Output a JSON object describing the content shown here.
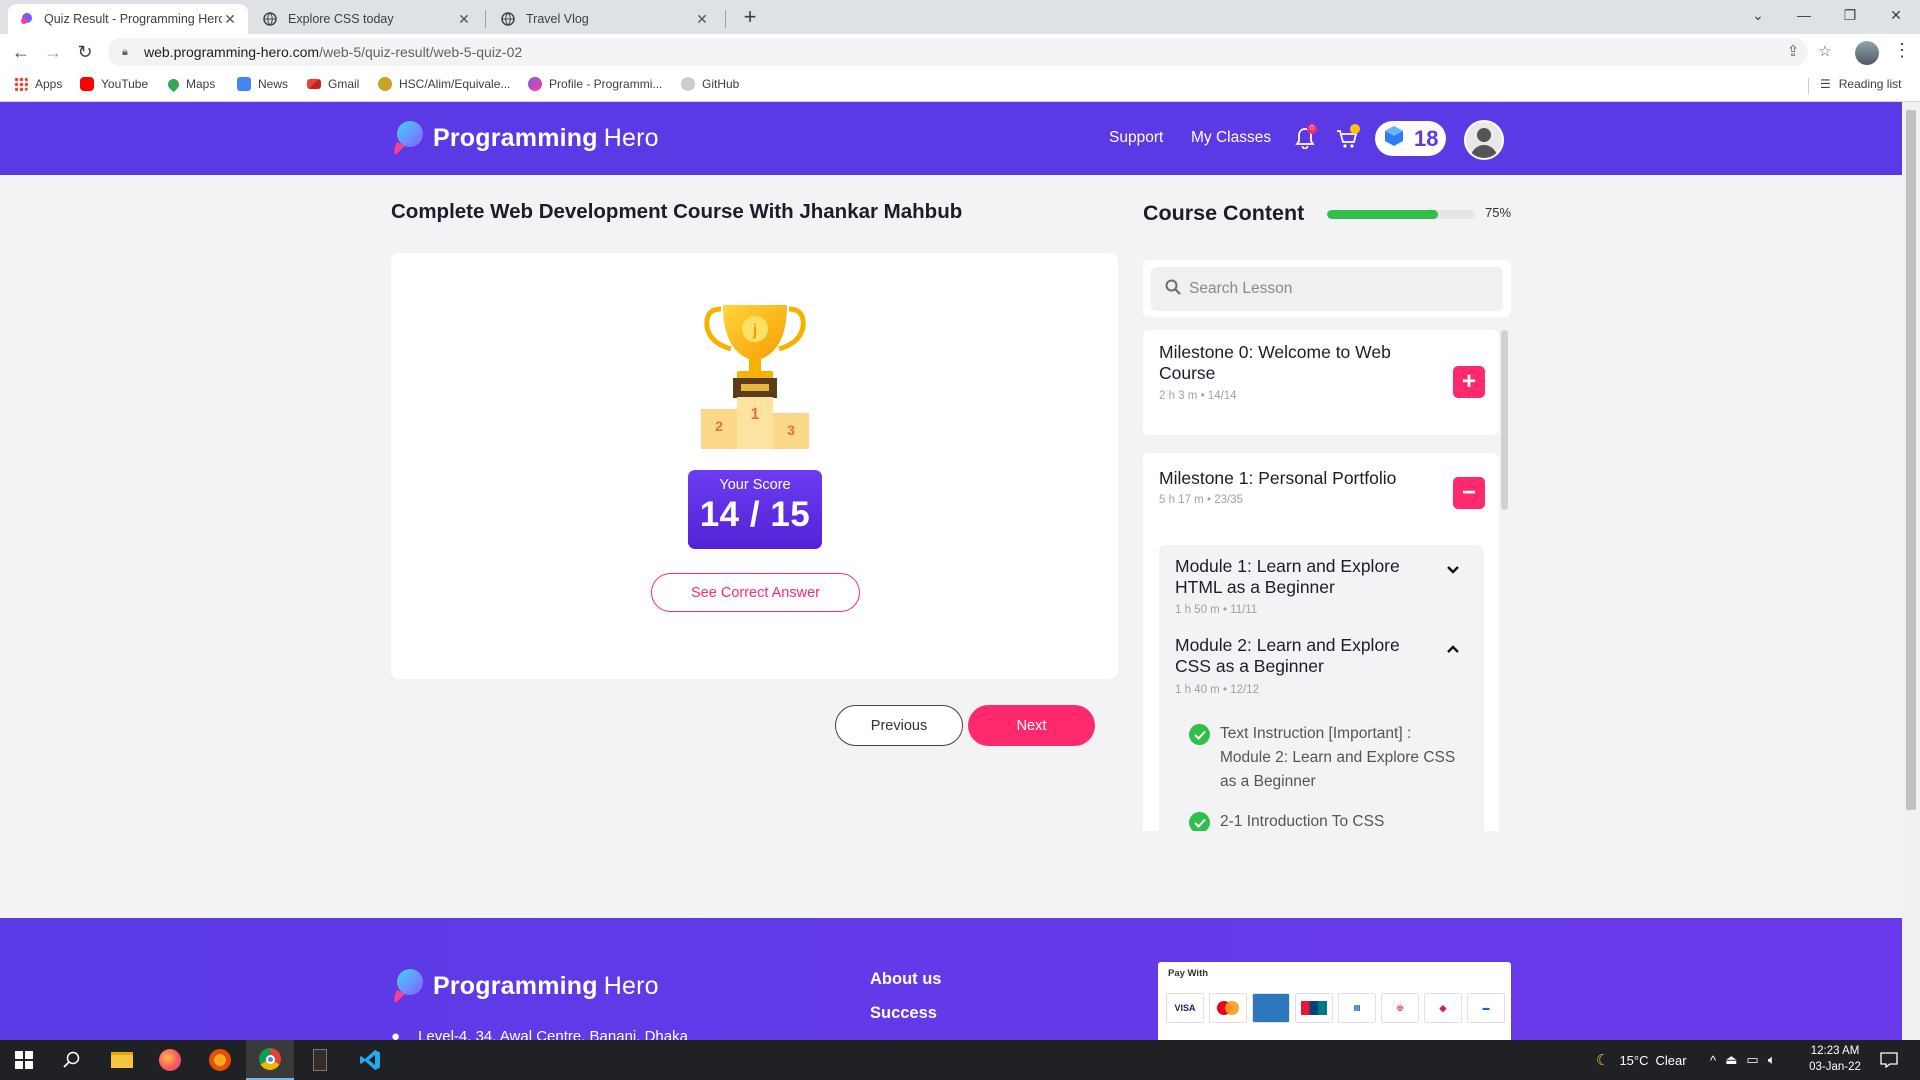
{
  "browser": {
    "tabs": [
      {
        "title": "Quiz Result - Programming Hero",
        "active": true
      },
      {
        "title": "Explore CSS today",
        "active": false
      },
      {
        "title": "Travel Vlog",
        "active": false
      }
    ],
    "url_host": "web.programming-hero.com",
    "url_path": "/web-5/quiz-result/web-5-quiz-02",
    "bookmarks": [
      "Apps",
      "YouTube",
      "Maps",
      "News",
      "Gmail",
      "HSC/Alim/Equivale...",
      "Profile - Programmi...",
      "GitHub"
    ],
    "reading_list": "Reading list"
  },
  "header": {
    "logo_programming": "Programming",
    "logo_hero": "Hero",
    "nav": [
      "Support",
      "My Classes"
    ],
    "notification_count": "0",
    "gem_count": "18"
  },
  "main": {
    "course_title": "Complete Web Development Course With Jhankar Mahbub",
    "score_label": "Your Score",
    "score_value": "14 / 15",
    "see_answer_label": "See Correct Answer",
    "previous_label": "Previous",
    "next_label": "Next"
  },
  "sidebar": {
    "title": "Course Content",
    "progress_percent": 75,
    "progress_text": "75%",
    "search_placeholder": "Search Lesson",
    "milestones": [
      {
        "title": "Milestone 0: Welcome to Web Course",
        "duration": "2 h 3 m",
        "count": "14/14",
        "toggle": "+"
      },
      {
        "title": "Milestone 1: Personal Portfolio",
        "duration": "5 h 17 m",
        "count": "23/35",
        "toggle": "−"
      }
    ],
    "modules": [
      {
        "title": "Module 1: Learn and Explore HTML as a Beginner",
        "duration": "1 h 50 m",
        "count": "11/11"
      },
      {
        "title": "Module 2: Learn and Explore CSS as a Beginner",
        "duration": "1 h 40 m",
        "count": "12/12"
      }
    ],
    "lessons": [
      "Text Instruction [Important] : Module 2: Learn and Explore CSS as a Beginner",
      "2-1 Introduction To CSS"
    ]
  },
  "footer": {
    "links": [
      "About us",
      "Success"
    ],
    "address": "Level-4, 34, Awal Centre, Banani, Dhaka",
    "pay_with": "Pay With",
    "payment_logos": [
      "VISA",
      "MC",
      "AMEX",
      "UnionPay",
      "DBBL",
      "Dutch",
      "bKash",
      "Bank"
    ]
  },
  "taskbar": {
    "temperature": "15°C",
    "weather": "Clear",
    "time": "12:23 AM",
    "date": "03-Jan-22"
  }
}
